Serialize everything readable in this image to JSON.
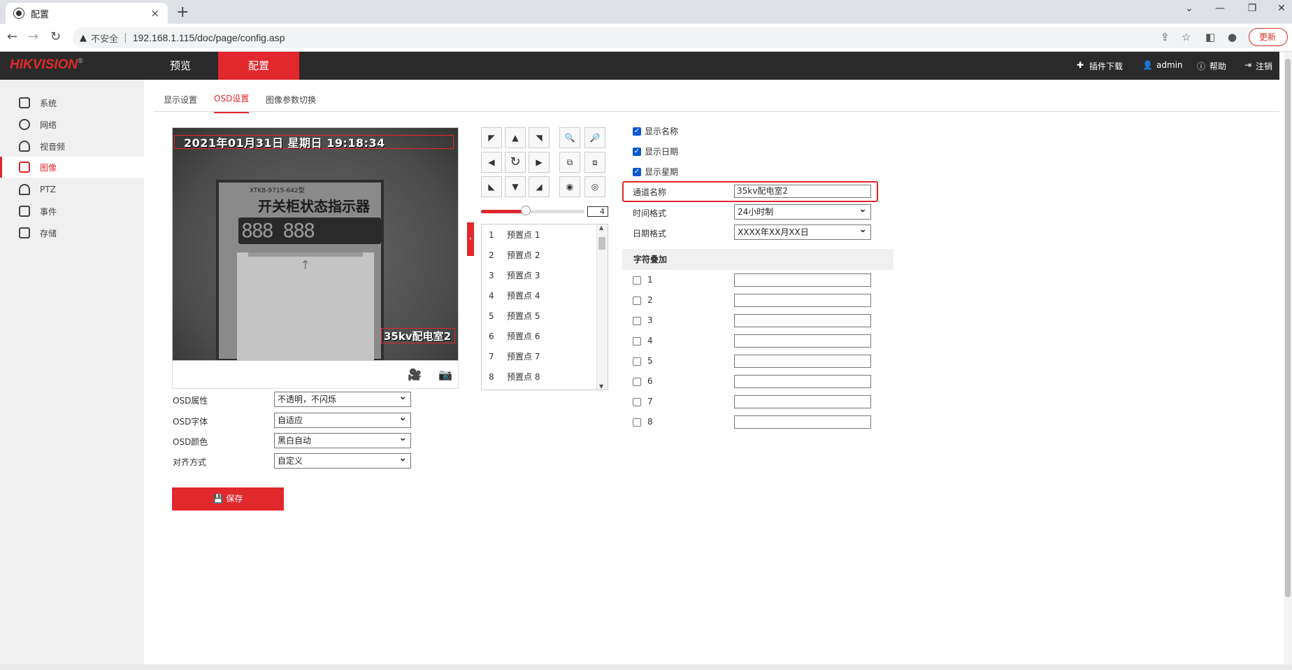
{
  "browser": {
    "tab_title": "配置",
    "tab_close": "×",
    "new_tab": "+",
    "security_label": "不安全",
    "url": "192.168.1.115/doc/page/config.asp",
    "update_label": "更新"
  },
  "header": {
    "logo": "HIKVISION",
    "logo_mark": "®",
    "nav": [
      {
        "label": "预览"
      },
      {
        "label": "配置"
      }
    ],
    "links": {
      "plugin": "插件下载",
      "user": "admin",
      "help": "帮助",
      "logout": "注销"
    }
  },
  "sidebar": {
    "items": [
      {
        "label": "系统",
        "icon": "system-icon"
      },
      {
        "label": "网络",
        "icon": "network-icon"
      },
      {
        "label": "视音频",
        "icon": "audio-video-icon"
      },
      {
        "label": "图像",
        "icon": "image-icon",
        "active": true
      },
      {
        "label": "PTZ",
        "icon": "ptz-icon"
      },
      {
        "label": "事件",
        "icon": "event-icon"
      },
      {
        "label": "存储",
        "icon": "storage-icon"
      }
    ]
  },
  "subtabs": [
    {
      "label": "显示设置"
    },
    {
      "label": "OSD设置",
      "active": true
    },
    {
      "label": "图像参数切换"
    }
  ],
  "video": {
    "osd_date": "2021年01月31日 星期日 19:18:34",
    "osd_name": "35kv配电室2",
    "panel_model": "XTK8-9715-642型",
    "panel_title": "开关柜状态指示器",
    "panel_digits": "888 888"
  },
  "ptz": {
    "speed": "4",
    "speed_fraction": 0.43,
    "presets": [
      {
        "num": "1",
        "label": "预置点 1"
      },
      {
        "num": "2",
        "label": "预置点 2"
      },
      {
        "num": "3",
        "label": "预置点 3"
      },
      {
        "num": "4",
        "label": "预置点 4"
      },
      {
        "num": "5",
        "label": "预置点 5"
      },
      {
        "num": "6",
        "label": "预置点 6"
      },
      {
        "num": "7",
        "label": "预置点 7"
      },
      {
        "num": "8",
        "label": "预置点 8"
      }
    ]
  },
  "osd_form": {
    "attr_label": "OSD属性",
    "attr_value": "不透明，不闪烁",
    "font_label": "OSD字体",
    "font_value": "自适应",
    "color_label": "OSD颜色",
    "color_value": "黑白自动",
    "align_label": "对齐方式",
    "align_value": "自定义",
    "save_label": "保存"
  },
  "display_form": {
    "show_name": "显示名称",
    "show_date": "显示日期",
    "show_week": "显示星期",
    "channel_name_label": "通道名称",
    "channel_name_value": "35kv配电室2",
    "time_format_label": "时间格式",
    "time_format_value": "24小时制",
    "date_format_label": "日期格式",
    "date_format_value": "XXXX年XX月XX日",
    "overlay_header": "字符叠加",
    "overlay_rows": [
      {
        "label": "1",
        "value": ""
      },
      {
        "label": "2",
        "value": ""
      },
      {
        "label": "3",
        "value": ""
      },
      {
        "label": "4",
        "value": ""
      },
      {
        "label": "5",
        "value": ""
      },
      {
        "label": "6",
        "value": ""
      },
      {
        "label": "7",
        "value": ""
      },
      {
        "label": "8",
        "value": ""
      }
    ]
  },
  "colors": {
    "accent": "#e0282d",
    "header_bg": "#2a2a2a",
    "checkbox_on": "#0b57d0"
  }
}
